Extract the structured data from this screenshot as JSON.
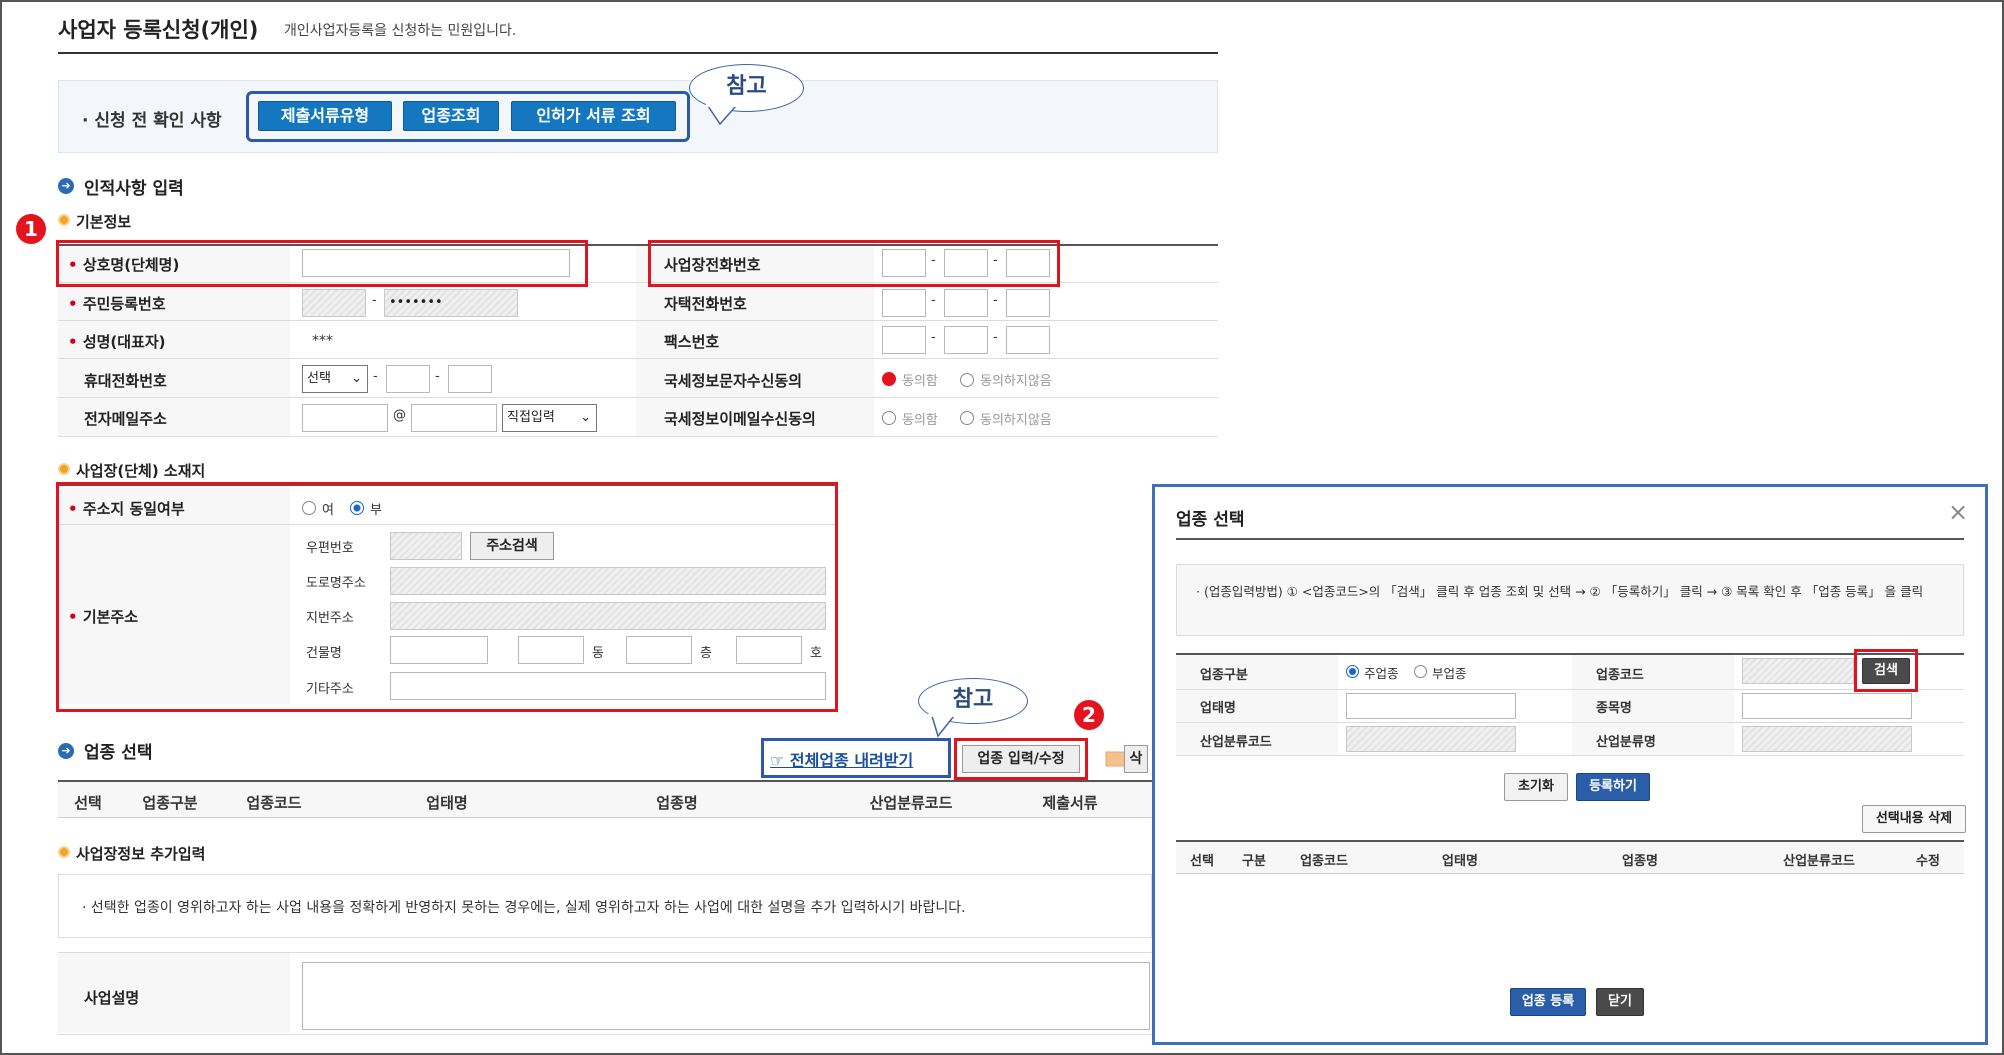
{
  "page": {
    "title": "사업자 등록신청(개인)",
    "subtitle": "개인사업자등록을 신청하는 민원입니다."
  },
  "pre_check": {
    "label": "· 신청 전 확인 사항",
    "buttons": [
      "제출서류유형",
      "업종조회",
      "인허가 서류 조회"
    ],
    "callout": "참고"
  },
  "personal": {
    "section_title": "인적사항 입력",
    "sub_title": "기본정보",
    "badge1": "1",
    "rows_left": [
      {
        "label": "상호명(단체명)",
        "required": "•"
      },
      {
        "label": "주민등록번호",
        "required": "•",
        "masked": "•••••••"
      },
      {
        "label": "성명(대표자)",
        "required": "•",
        "value": "***"
      },
      {
        "label": "휴대전화번호",
        "required": "",
        "select": "선택"
      },
      {
        "label": "전자메일주소",
        "required": "",
        "at": "@",
        "select": "직접입력"
      }
    ],
    "rows_right": [
      {
        "label": "사업장전화번호"
      },
      {
        "label": "자택전화번호"
      },
      {
        "label": "팩스번호"
      },
      {
        "label": "국세정보문자수신동의",
        "opt1": "동의함",
        "opt2": "동의하지않음"
      },
      {
        "label": "국세정보이메일수신동의",
        "opt1": "동의함",
        "opt2": "동의하지않음"
      }
    ],
    "dash": "-"
  },
  "address": {
    "sub_title": "사업장(단체) 소재지",
    "same_label": "주소지 동일여부",
    "same_yes": "여",
    "same_no": "부",
    "basic_label": "기본주소",
    "required": "•",
    "zip_label": "우편번호",
    "zip_button": "주소검색",
    "road_label": "도로명주소",
    "lot_label": "지번주소",
    "building_label": "건물명",
    "dong": "동",
    "floor": "층",
    "ho": "호",
    "etc_label": "기타주소"
  },
  "business": {
    "section_title": "업종 선택",
    "download_link": "☞ 전체업종 내려받기",
    "edit_button": "업종 입력/수정",
    "callout": "참고",
    "badge2": "2",
    "cut_char": "삭",
    "headers": [
      "선택",
      "업종구분",
      "업종코드",
      "업태명",
      "업종명",
      "산업분류코드",
      "제출서류"
    ]
  },
  "extra": {
    "sub_title": "사업장정보 추가입력",
    "notice": "· 선택한 업종이 영위하고자 하는 사업 내용을 정확하게 반영하지 못하는 경우에는, 실제 영위하고자 하는 사업에 대한 설명을 추가 입력하시기 바랍니다.",
    "desc_label": "사업설명"
  },
  "modal": {
    "title": "업종 선택",
    "close": "×",
    "guide": "· (업종입력방법) ① <업종코드>의 「검색」 클릭 후 업종 조회 및 선택 → ② 「등록하기」 클릭 → ③ 목록 확인 후 「업종 등록」 을 클릭",
    "type_label": "업종구분",
    "main_type": "주업종",
    "sub_type": "부업종",
    "code_label": "업종코드",
    "search_button": "검색",
    "biz_label": "업태명",
    "item_label": "종목명",
    "industry_label": "산업분류코드",
    "industry_name_label": "산업분류명",
    "reset_button": "초기화",
    "register_button": "등록하기",
    "delete_button": "선택내용 삭제",
    "headers": [
      "선택",
      "구분",
      "업종코드",
      "업태명",
      "업종명",
      "산업분류코드",
      "수정"
    ],
    "submit_button": "업종 등록",
    "close_button": "닫기"
  },
  "colors": {
    "accent_blue": "#1577c0",
    "highlight_red": "#e0141e",
    "frame_blue": "#3f6fb7",
    "dark_button": "#4a4a4a"
  }
}
